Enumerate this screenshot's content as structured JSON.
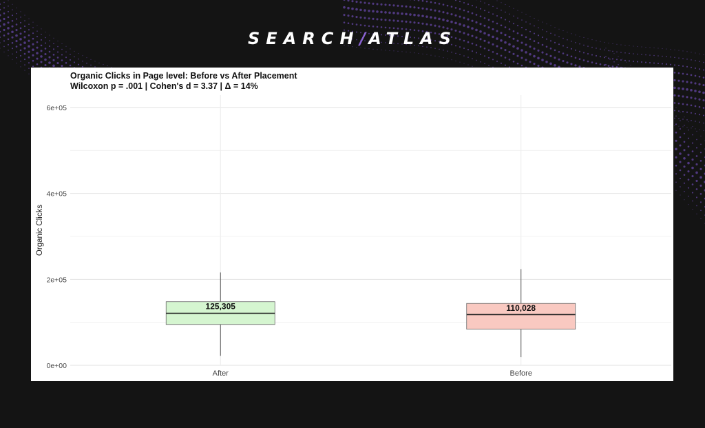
{
  "brand": {
    "left": "SEARCH",
    "slash": "/",
    "right": "ATLAS"
  },
  "colors": {
    "background": "#141414",
    "wave_purple": "#5b3f93",
    "logo_accent": "#8a63d2",
    "after_fill": "#d5f5d0",
    "before_fill": "#f9c9c1"
  },
  "chart_data": {
    "type": "box",
    "title": "Organic Clicks in Page level: Before vs After Placement",
    "subtitle": "Wilcoxon p = .001 | Cohen's d = 3.37 | Δ = 14%",
    "xlabel": "",
    "ylabel": "Organic Clicks",
    "ylim": [
      0,
      600000
    ],
    "yticks": [
      0,
      200000,
      400000,
      600000
    ],
    "ytick_labels": [
      "0e+00",
      "2e+05",
      "4e+05",
      "6e+05"
    ],
    "grid": true,
    "categories": [
      "After",
      "Before"
    ],
    "boxes": [
      {
        "category": "After",
        "min": 22000,
        "q1": 95000,
        "median": 121000,
        "q3": 148000,
        "max": 216000,
        "label": "125,305",
        "fill": "#d5f5d0"
      },
      {
        "category": "Before",
        "min": 19000,
        "q1": 84000,
        "median": 118000,
        "q3": 144000,
        "max": 224000,
        "label": "110,028",
        "fill": "#f9c9c1"
      }
    ]
  }
}
